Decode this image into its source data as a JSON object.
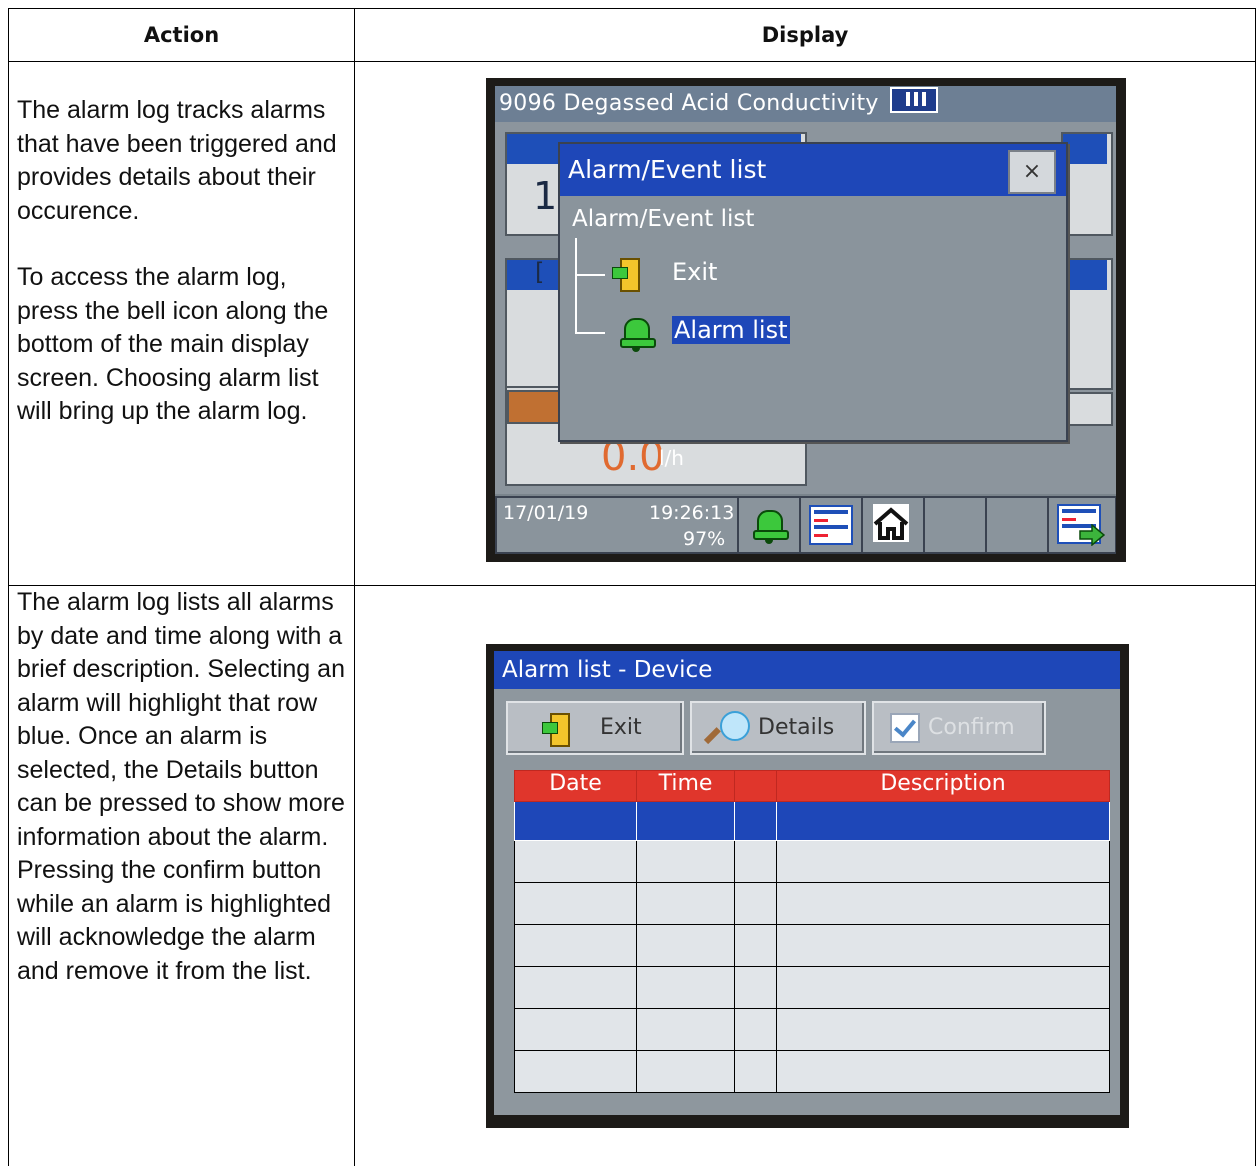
{
  "headers": {
    "action": "Action",
    "display": "Display"
  },
  "row1": {
    "action_p1": "The alarm log tracks alarms that have been triggered and provides details about their occurence.",
    "action_p2": "To access the alarm log, press the bell icon along the bottom of the main display screen. Choosing alarm list will bring up the alarm log.",
    "screen": {
      "title": "9096 Degassed Acid Conductivity",
      "panel_digit": "1",
      "panel_letter": "[",
      "flow_value": "0.0",
      "flow_unit": "l/h",
      "dialog": {
        "title": "Alarm/Event list",
        "close_label": "×",
        "tree_root": "Alarm/Event list",
        "item_exit": "Exit",
        "item_alarm_list": "Alarm list"
      },
      "status": {
        "date": "17/01/19",
        "time": "19:26:13",
        "percent": "97%"
      }
    }
  },
  "row2": {
    "action_p1": "The alarm log lists all alarms by date and time along with a brief description.   Selecting an alarm will highlight that row blue.  Once an alarm is selected, the Details button can be pressed to show more information about the alarm.",
    "action_p2": "Pressing the confirm button while an alarm is highlighted will acknowledge the alarm and remove it from the list.",
    "screen": {
      "title": "Alarm list - Device",
      "btn_exit": "Exit",
      "btn_details": "Details",
      "btn_confirm": "Confirm",
      "columns": [
        "Date",
        "Time",
        "",
        "Description"
      ],
      "selected_row": 0,
      "row_count": 7
    }
  },
  "colors": {
    "lcd_blue": "#1e47b8",
    "header_red": "#e0362c",
    "bell_green": "#3cc83c",
    "value_orange": "#e06a30"
  }
}
